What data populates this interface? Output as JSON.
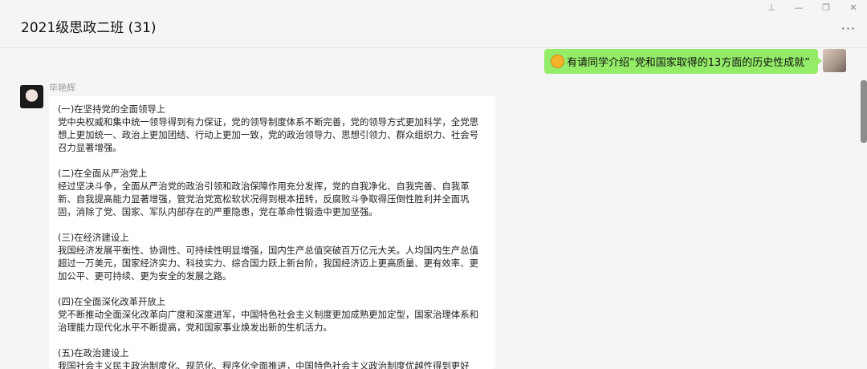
{
  "header": {
    "title": "2021级思政二班 (31)"
  },
  "window_controls": [
    {
      "name": "pin-icon",
      "glyph": "⊥"
    },
    {
      "name": "minimize-icon",
      "glyph": "—"
    },
    {
      "name": "maximize-icon",
      "glyph": "❐"
    },
    {
      "name": "close-icon",
      "glyph": "✕"
    }
  ],
  "more_glyph": "···",
  "messages": {
    "me": {
      "text": "有请同学介绍“党和国家取得的13方面的历史性成就”",
      "emoji": "smile-emoji"
    },
    "other": {
      "sender": "毕艳辉",
      "sections": [
        {
          "title": "(一)在坚持党的全面领导上",
          "body": "党中央权威和集中统一领导得到有力保证，党的领导制度体系不断完善，党的领导方式更加科学，全党思想上更加统一、政治上更加团结、行动上更加一致，党的政治领导力、思想引领力、群众组织力、社会号召力显著增强。"
        },
        {
          "title": "(二)在全面从严治党上",
          "body": "经过坚决斗争，全面从严治党的政治引领和政治保障作用充分发挥，党的自我净化、自我完善、自我革新、自我提高能力显著增强，管党治党宽松软状况得到根本扭转，反腐败斗争取得压倒性胜利并全面巩固，消除了党、国家、军队内部存在的严重隐患，党在革命性锻造中更加坚强。"
        },
        {
          "title": "(三)在经济建设上",
          "body": "我国经济发展平衡性、协调性、可持续性明显增强，国内生产总值突破百万亿元大关。人均国内生产总值超过一万美元，国家经济实力、科技实力、综合国力跃上新台阶，我国经济迈上更高质量、更有效率、更加公平、更可持续、更为安全的发展之路。"
        },
        {
          "title": "(四)在全面深化改革开放上",
          "body": "党不断推动全面深化改革向广度和深度进军，中国特色社会主义制度更加成熟更加定型，国家治理体系和治理能力现代化水平不断提高，党和国家事业焕发出新的生机活力。"
        },
        {
          "title": "(五)在政治建设上",
          "body": "我国社会主义民主政治制度化、规范化、程序化全面推进，中国特色社会主义政治制度优越性得到更好"
        }
      ]
    }
  }
}
